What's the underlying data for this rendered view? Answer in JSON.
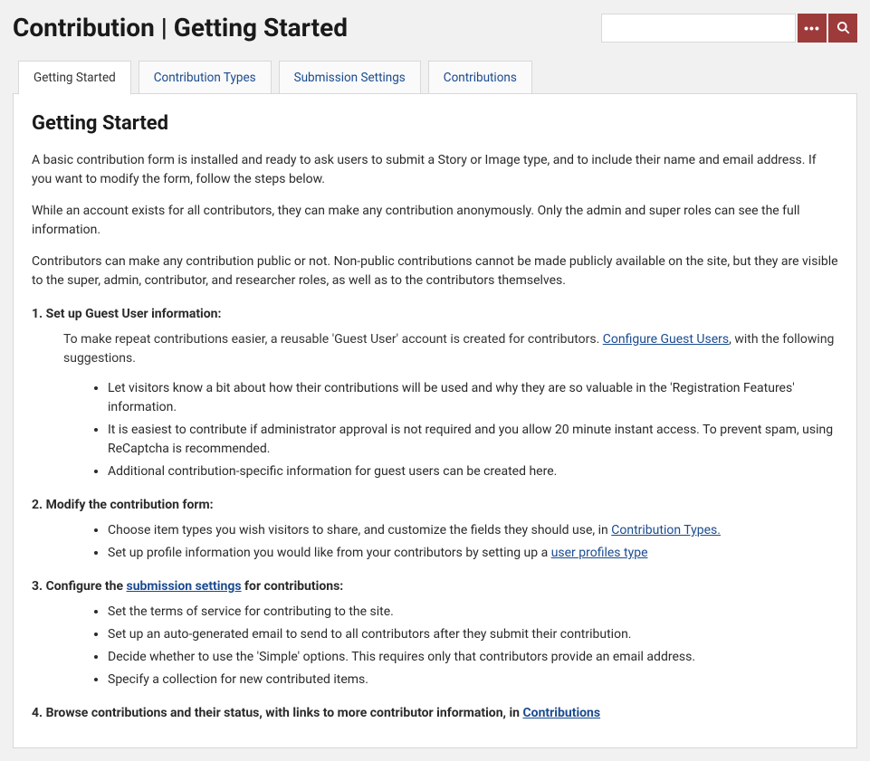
{
  "header": {
    "title": "Contribution | Getting Started"
  },
  "search": {
    "value": ""
  },
  "tabs": [
    {
      "label": "Getting Started",
      "active": true
    },
    {
      "label": "Contribution Types",
      "active": false
    },
    {
      "label": "Submission Settings",
      "active": false
    },
    {
      "label": "Contributions",
      "active": false
    }
  ],
  "main": {
    "heading": "Getting Started",
    "intro1": "A basic contribution form is installed and ready to ask users to submit a Story or Image type, and to include their name and email address. If you want to modify the form, follow the steps below.",
    "intro2": "While an account exists for all contributors, they can make any contribution anonymously. Only the admin and super roles can see the full information.",
    "intro3": "Contributors can make any contribution public or not. Non-public contributions cannot be made publicly available on the site, but they are visible to the super, admin, contributor, and researcher roles, as well as to the contributors themselves.",
    "step1": {
      "heading": "1. Set up Guest User information:",
      "desc_prefix": "To make repeat contributions easier, a reusable 'Guest User' account is created for contributors. ",
      "link": "Configure Guest Users",
      "desc_suffix": ", with the following suggestions.",
      "items": [
        "Let visitors know a bit about how their contributions will be used and why they are so valuable in the 'Registration Features' information.",
        "It is easiest to contribute if administrator approval is not required and you allow 20 minute instant access. To prevent spam, using ReCaptcha is recommended.",
        "Additional contribution-specific information for guest users can be created here."
      ]
    },
    "step2": {
      "heading": "2. Modify the contribution form:",
      "item1_prefix": "Choose item types you wish visitors to share, and customize the fields they should use, in ",
      "item1_link": "Contribution Types.",
      "item2_prefix": "Set up profile information you would like from your contributors by setting up a ",
      "item2_link": "user profiles type"
    },
    "step3": {
      "heading_prefix": "3. Configure the ",
      "heading_link": "submission settings",
      "heading_suffix": " for contributions:",
      "items": [
        "Set the terms of service for contributing to the site.",
        "Set up an auto-generated email to send to all contributors after they submit their contribution.",
        "Decide whether to use the 'Simple' options. This requires only that contributors provide an email address.",
        "Specify a collection for new contributed items."
      ]
    },
    "step4": {
      "heading_prefix": "4. Browse contributions and their status, with links to more contributor information, in ",
      "heading_link": "Contributions"
    }
  }
}
